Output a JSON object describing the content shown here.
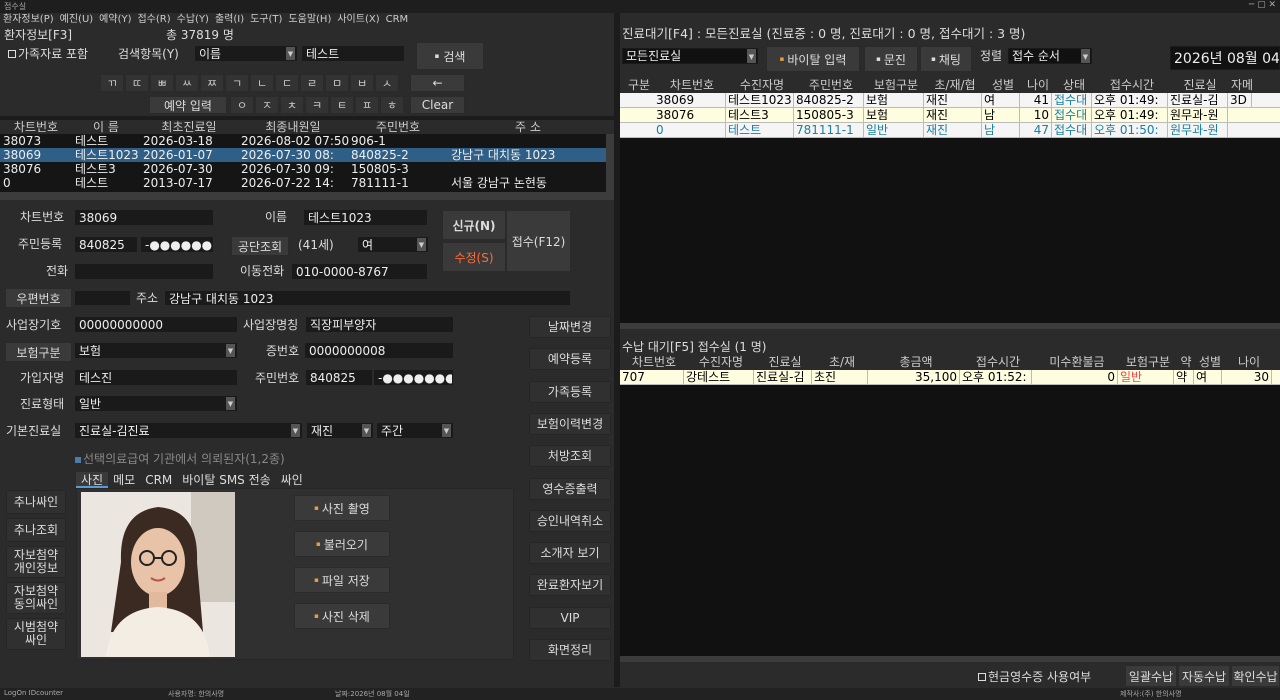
{
  "window": {
    "title": "접수실"
  },
  "menu": [
    "환자정보(P)",
    "예진(U)",
    "예약(Y)",
    "접수(R)",
    "수납(Y)",
    "출력(I)",
    "도구(T)",
    "도움말(H)",
    "사이트(X)",
    "CRM"
  ],
  "patient_info": {
    "title": "환자정보[F3]",
    "total": "총 37819 명"
  },
  "search": {
    "family_check": "가족자료 포함",
    "item_label": "검색항목(Y)",
    "item_value": "이름",
    "query": "테스트",
    "search_btn": "검색",
    "reserve_btn": "예약 입력",
    "clear_btn": "Clear",
    "back_btn": "←",
    "keys_row1": [
      "ㄲ",
      "ㄸ",
      "ㅃ",
      "ㅆ",
      "ㅉ",
      "ㄱ",
      "ㄴ",
      "ㄷ",
      "ㄹ",
      "ㅁ",
      "ㅂ",
      "ㅅ"
    ],
    "keys_row2": [
      "ㅇ",
      "ㅈ",
      "ㅊ",
      "ㅋ",
      "ㅌ",
      "ㅍ",
      "ㅎ"
    ]
  },
  "patient_table": {
    "headers": [
      "차트번호",
      "이 름",
      "최초진료일",
      "최종내원일",
      "주민번호",
      "주 소",
      ":폰"
    ],
    "rows": [
      [
        "38073",
        "테스트",
        "2026-03-18",
        "2026-08-02 07:50",
        "906-1",
        "",
        "010-"
      ],
      [
        "38069",
        "테스트1023",
        "2026-01-07",
        "2026-07-30 08:",
        "840825-2",
        "강남구 대치동 1023",
        "010-"
      ],
      [
        "38076",
        "테스트3",
        "2026-07-30",
        "2026-07-30 09:",
        "150805-3",
        "",
        "010-"
      ],
      [
        "0",
        "테스트",
        "2013-07-17",
        "2026-07-22 14:",
        "781111-1",
        "서울 강남구 논현동",
        "010-"
      ]
    ]
  },
  "detail": {
    "chart_label": "차트번호",
    "chart_value": "38069",
    "name_label": "이름",
    "name_value": "테스트1023",
    "jumin_label": "주민등록",
    "jumin_front": "840825",
    "jumin_back": "-●●●●●●●",
    "gongdan_btn": "공단조회",
    "age": "(41세)",
    "gender": "여",
    "phone_label": "전화",
    "phone_value": "",
    "mobile_label": "이동전화",
    "mobile_value": "010-0000-8767",
    "zip_btn": "우편번호",
    "address_label": "주소",
    "address_value": "강남구 대치동 1023",
    "biz_label": "사업장기호",
    "biz_value": "00000000000",
    "bizname_label": "사업장명칭",
    "bizname_value": "직장피부양자",
    "ins_label": "보험구분",
    "ins_value": "보험",
    "cert_label": "증번호",
    "cert_value": "0000000008",
    "subscriber_label": "가입자명",
    "subscriber_value": "테스진",
    "sub_jumin_label": "주민번호",
    "sub_jumin_front": "840825",
    "sub_jumin_back": "-●●●●●●●",
    "type_label": "진료형태",
    "type_value": "일반",
    "room_label": "기본진료실",
    "room_value": "진료실-김진료",
    "visit_value": "재진",
    "time_value": "주간",
    "referral": "선택의료급여 기관에서 의뢰된자(1,2종)",
    "new_btn": "신규(N)",
    "edit_btn": "수정(S)",
    "reception_btn": "접수(F12)"
  },
  "tabs": [
    "사진",
    "메모",
    "CRM",
    "바이탈 SMS 전송",
    "싸인"
  ],
  "photo_btns": [
    "사진 촬영",
    "불러오기",
    "파일 저장",
    "사진 삭제"
  ],
  "left_side_btns": [
    "추나싸인",
    "추나조회",
    "자보첨약\n개인정보",
    "자보첨약\n동의싸인",
    "시범첨약\n싸인"
  ],
  "right_side_btns": [
    "날짜변경",
    "예약등록",
    "가족등록",
    "보험이력변경",
    "처방조회",
    "영수증출력",
    "승인내역취소",
    "소개자 보기",
    "완료환자보기",
    "VIP",
    "화면정리"
  ],
  "waiting": {
    "title": "진료대기[F4] : 모든진료실 (진료중 : 0 명, 진료대기 : 0 명, 접수대기 : 3 명)",
    "room_select": "모든진료실",
    "vital_btn": "바이탈 입력",
    "exam_btn": "문진",
    "chat_btn": "채팅",
    "sort_label": "정렬",
    "sort_value": "접수 순서",
    "date": "2026년 08월 04일",
    "headers": [
      "구분",
      "차트번호",
      "수진자명",
      "주민번호",
      "보험구분",
      "초/재/협",
      "성별",
      "나이",
      "상태",
      "접수시간",
      "진료실",
      "자메"
    ],
    "rows": [
      [
        "",
        "38069",
        "테스트1023",
        "840825-2",
        "보험",
        "재진",
        "여",
        "41",
        "접수대",
        "오후 01:49:",
        "진료실-김",
        "3D"
      ],
      [
        "",
        "38076",
        "테스트3",
        "150805-3",
        "보험",
        "재진",
        "남",
        "10",
        "접수대",
        "오후 01:49:",
        "원무과-원",
        ""
      ],
      [
        "",
        "0",
        "테스트",
        "781111-1",
        "일반",
        "재진",
        "남",
        "47",
        "접수대",
        "오후 01:50:",
        "원무과-원",
        ""
      ]
    ]
  },
  "payment": {
    "title": "수납 대기[F5] 접수실 (1 명)",
    "headers": [
      "차트번호",
      "수진자명",
      "진료실",
      "초/재",
      "총금액",
      "접수시간",
      "미수환불금",
      "보험구분",
      "약",
      "성별",
      "나이"
    ],
    "rows": [
      [
        "707",
        "강테스트",
        "진료실-김",
        "초진",
        "35,100",
        "오후 01:52:",
        "0",
        "일반",
        "약",
        "여",
        "30"
      ]
    ]
  },
  "bottom": {
    "cash_check": "현금영수증 사용여부",
    "btn1": "일괄수납",
    "btn2": "자동수납",
    "btn3": "확인수납"
  },
  "status": {
    "logon": "LogOn IDcounter",
    "user": "사용자명: 한의사명",
    "date": "날짜:2026년 08월 04일",
    "company": "제작사:(주) 한의사명"
  },
  "colors": {
    "selected_row": "#2f5e86",
    "yellow_row": "#fffde0",
    "header_red": "#ff4040"
  }
}
